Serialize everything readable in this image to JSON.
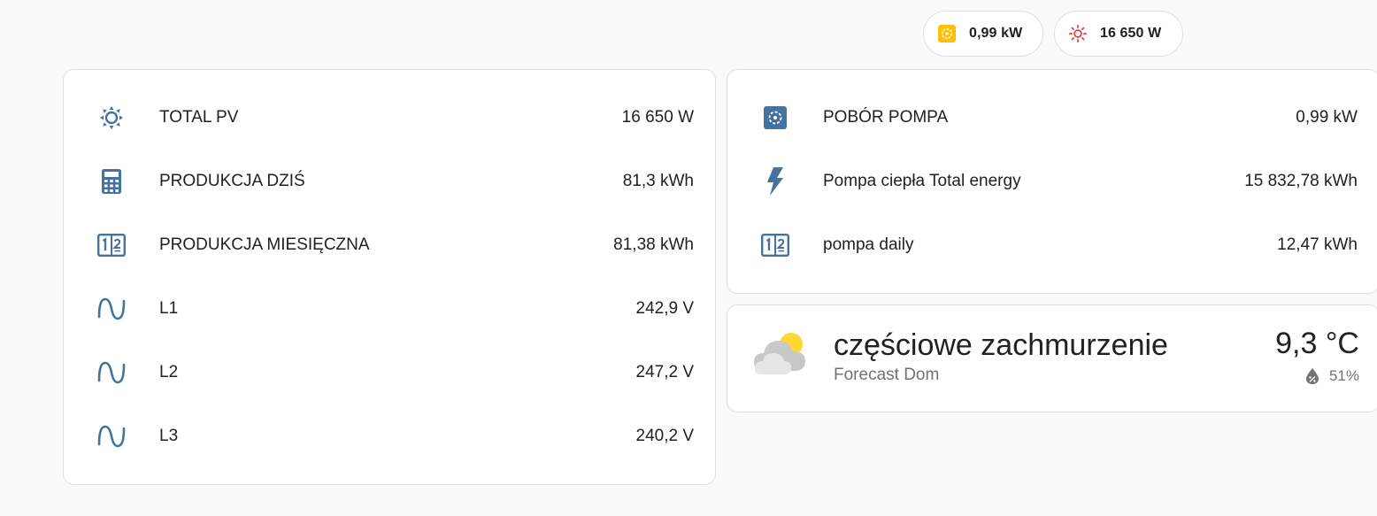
{
  "chips": [
    {
      "value": "0,99 kW",
      "icon": "heat-pump-icon",
      "color": "#ffc107"
    },
    {
      "value": "16 650 W",
      "icon": "solar-power-icon",
      "color": "#e53935"
    }
  ],
  "left_card": {
    "rows": [
      {
        "label": "TOTAL PV",
        "value": "16 650 W",
        "icon": "solar-power-icon"
      },
      {
        "label": "PRODUKCJA DZIŚ",
        "value": "81,3 kWh",
        "icon": "calculator-icon"
      },
      {
        "label": "PRODUKCJA MIESIĘCZNA",
        "value": "81,38 kWh",
        "icon": "counter-icon"
      },
      {
        "label": "L1",
        "value": "242,9 V",
        "icon": "sine-wave-icon"
      },
      {
        "label": "L2",
        "value": "247,2 V",
        "icon": "sine-wave-icon"
      },
      {
        "label": "L3",
        "value": "240,2 V",
        "icon": "sine-wave-icon"
      }
    ]
  },
  "right_card": {
    "rows": [
      {
        "label": "POBÓR POMPA",
        "value": "0,99 kW",
        "icon": "heat-pump-icon"
      },
      {
        "label": "Pompa ciepła Total energy",
        "value": "15 832,78 kWh",
        "icon": "flash-icon"
      },
      {
        "label": "pompa daily",
        "value": "12,47 kWh",
        "icon": "counter-icon"
      }
    ]
  },
  "weather": {
    "condition": "częściowe zachmurzenie",
    "name": "Forecast Dom",
    "temperature": "9,3 °C",
    "humidity": "51%",
    "icon": "partly-cloudy-icon",
    "humidity_icon": "water-percent-icon"
  },
  "colors": {
    "icon": "#44739e",
    "chip_sun": "#ffc107",
    "chip_red": "#e53935",
    "background": "#fafafa",
    "card": "#ffffff"
  }
}
